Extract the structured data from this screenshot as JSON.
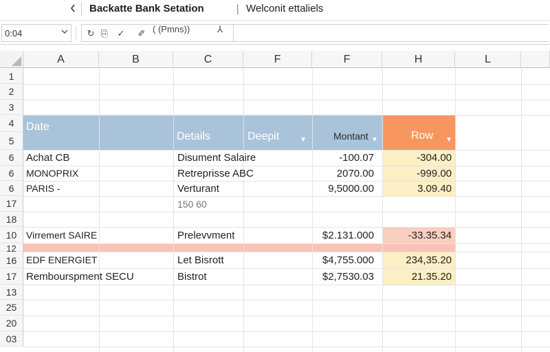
{
  "titlebar": {
    "back_icon": "chevron-left-icon",
    "title": "Backatte Bank Setation",
    "sub_marker": "⸽",
    "subtitle": "Welconit ettaliels"
  },
  "formula_bar": {
    "name_box": "0:04",
    "tools": [
      "↻",
      "⎘",
      "✓",
      "✐"
    ],
    "formula_text": "( (Pmns))",
    "fx_symbol": "⅄",
    "value": ""
  },
  "columns": [
    "A",
    "B",
    "C",
    "F",
    "F",
    "H",
    "L"
  ],
  "row_numbers": [
    "1",
    "2",
    "3",
    "4",
    "5",
    "6",
    "6",
    "6",
    "17",
    "18",
    "10",
    "12",
    "16",
    "17",
    "13",
    "25",
    "20",
    "03"
  ],
  "header_row": {
    "date": "Date",
    "details": "Details",
    "deposit": "Deepit",
    "amount": "Montant",
    "row": "Row"
  },
  "table_rows": [
    {
      "a": "Achat CB",
      "c": "Disument Salaire",
      "f": "-100.07",
      "h": "-304.00"
    },
    {
      "a": "MONOPRIX",
      "c": "Retreprisse ABC",
      "f": "2070.00",
      "h": "-999.00"
    },
    {
      "a": "PARIS -",
      "c": "Verturant",
      "f": "9,5000.00",
      "h": "3.09.40"
    },
    {
      "a": "",
      "c": "150 60",
      "f": "",
      "h": ""
    },
    {
      "a": "",
      "c": "",
      "f": "",
      "h": ""
    },
    {
      "a": "Virremert SAIRE",
      "c": "Prelevvment",
      "f": "$2.131.000",
      "h": "-33.35.34"
    },
    {
      "a": "",
      "c": "",
      "f": "",
      "h": ""
    },
    {
      "a": "EDF ENERGIET",
      "c": "Let Bisrott",
      "f": "$4,755.000",
      "h": "234,35.20"
    },
    {
      "a": "Rembourspment SECU",
      "c": "Bistrot",
      "f": "$2,7530.03",
      "h": "21.35.20"
    }
  ],
  "colors": {
    "header_blue": "#a9c4da",
    "header_orange": "#f7965e",
    "highlight_yellow": "#fcefc4",
    "highlight_pink": "#f9cfc0",
    "band_pink": "#f8c3b4"
  }
}
